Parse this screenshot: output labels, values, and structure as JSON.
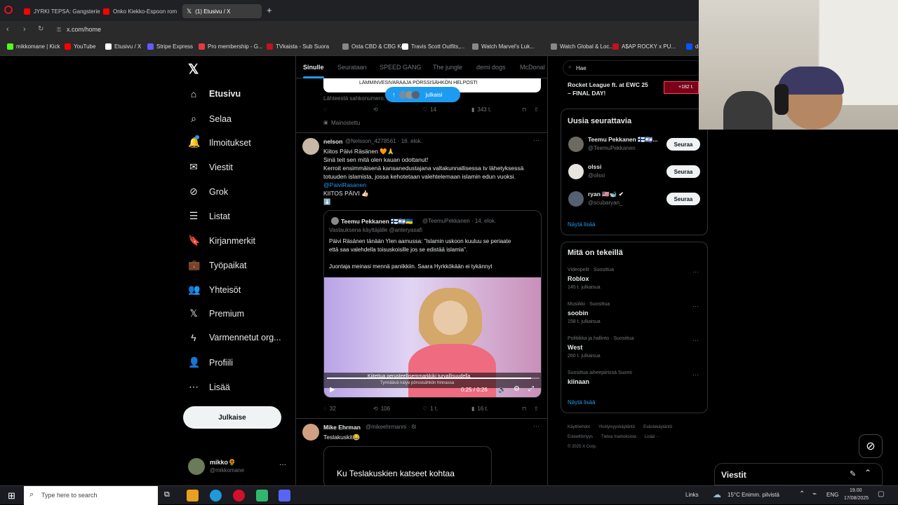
{
  "browser": {
    "tabs": [
      {
        "label": "JYRKI TEPSA: Gangsteriel",
        "color": "#ff0000"
      },
      {
        "label": "Onko Kiekko-Espoon rom",
        "color": "#ff0000"
      },
      {
        "label": "(1) Etusivu / X",
        "color": "#ffffff"
      }
    ],
    "new_tab": "+",
    "url": "x.com/home",
    "bookmarks": [
      {
        "label": "mikkomane | Kick",
        "color": "#53fc18"
      },
      {
        "label": "YouTube",
        "color": "#ff0000"
      },
      {
        "label": "Etusivu / X",
        "color": "#ffffff"
      },
      {
        "label": "Stripe Express",
        "color": "#635bff"
      },
      {
        "label": "Pro membership - G...",
        "color": "#e63946"
      },
      {
        "label": "TVkaista - Sub Suora",
        "color": "#c1121f"
      },
      {
        "label": "Osta CBD & CBG Ke...",
        "color": "#888888"
      },
      {
        "label": "Travis Scott Outfits,...",
        "color": "#ffffff"
      },
      {
        "label": "Watch Marvel's Luk...",
        "color": "#888888"
      },
      {
        "label": "Watch Global & Loc...",
        "color": "#888888"
      },
      {
        "label": "A$AP ROCKY x PU...",
        "color": "#c1121f"
      },
      {
        "label": "de",
        "color": "#0057ff"
      }
    ]
  },
  "left_nav": {
    "items": [
      {
        "label": "Etusivu",
        "icon": "home-icon",
        "glyph": "⌂"
      },
      {
        "label": "Selaa",
        "icon": "search-icon",
        "glyph": "⌕"
      },
      {
        "label": "Ilmoitukset",
        "icon": "bell-icon",
        "glyph": "🔔"
      },
      {
        "label": "Viestit",
        "icon": "mail-icon",
        "glyph": "✉"
      },
      {
        "label": "Grok",
        "icon": "grok-icon",
        "glyph": "⊘"
      },
      {
        "label": "Listat",
        "icon": "list-icon",
        "glyph": "☰"
      },
      {
        "label": "Kirjanmerkit",
        "icon": "bookmark-icon",
        "glyph": "🔖"
      },
      {
        "label": "Työpaikat",
        "icon": "briefcase-icon",
        "glyph": "💼"
      },
      {
        "label": "Yhteisöt",
        "icon": "community-icon",
        "glyph": "👥"
      },
      {
        "label": "Premium",
        "icon": "x-logo-icon",
        "glyph": "𝕏"
      },
      {
        "label": "Varmennetut org...",
        "icon": "lightning-icon",
        "glyph": "ϟ"
      },
      {
        "label": "Profiili",
        "icon": "profile-icon",
        "glyph": "👤"
      },
      {
        "label": "Lisää",
        "icon": "more-circle-icon",
        "glyph": "⋯"
      }
    ],
    "post_button": "Julkaise",
    "account": {
      "name": "mikko🌻",
      "handle": "@mikkomane",
      "more": "···"
    }
  },
  "feed": {
    "tabs": [
      "Sinulle",
      "Seurataan",
      "SPEED GANG",
      "The jungle",
      "demi dogs",
      "McDonal"
    ],
    "ad_tweet": {
      "card_text": "LÄMMINVESIVARAAJA PÖRSSISÄHKÖN HELPOSTI",
      "new_posts_pill": "julkaisi",
      "source": "Lähteestä sahkonumero.",
      "likes": "14",
      "views": "343 t.",
      "promoted": "Mainostettu"
    },
    "tweet1": {
      "name": "nelson",
      "handle": "@Nelsson_4278561 · 16. elok.",
      "lines": [
        "Kiitos Päivi Räsänen 🧡🙏",
        "Sinä teit sen mitä olen kauan odottanut!",
        "Kerroit ensimmäisenä kansanedustajana valtakunnallisessa tv lähetyksessä",
        "totuuden islamista, jossa kehotetaan valehtelemaan islamin edun vuoksi."
      ],
      "mention": "@PaiviRasanen",
      "line_after": "KIITOS PÄIVI 👍🏻",
      "emoji_line": "⬇️",
      "quote": {
        "name": "Teemu Pekkanen 🇫🇮🇮🇱🇺🇦",
        "handle": "@TeemuPekkanen · 14. elok.",
        "reply_to": "Vastauksena käyttäjälle @anteryasafi",
        "text1": "Päivi Räsänen tänään Ylen aamussa: \"Islamin uskoon kuuluu se periaate",
        "text2": "että saa valehdella toisuskoisille jos se edistää islamia\".",
        "text3": "Juontaja meinasi mennä paniikkiin. Saara Hyrkkökään ei tykännyt"
      },
      "video": {
        "caption": "Kiitettua perusteellisemmarkkiki turvallisuudella",
        "ticker": "Tyrmäävä naiye pörssisähkön hinnassa",
        "time": "0:25 / 0:26",
        "progress": 0.96
      },
      "replies": "32",
      "reposts": "106",
      "likes": "1 t.",
      "views": "16 t."
    },
    "tweet2": {
      "name": "Mike Ehrman",
      "handle": "@mikeehrmanni · 6t",
      "text": "Teslakuskit😂",
      "card_title": "Ku Teslakuskien katseet kohtaa"
    }
  },
  "right": {
    "search_text": "Hae",
    "top_trend": {
      "line1": "Rocket League ft. at EWC 25",
      "line2": "– FINAL DAY!",
      "badge": "+182 t."
    },
    "who_to_follow": {
      "title": "Uusia seurattavia",
      "users": [
        {
          "name": "Teemu Pekkanen 🇫🇮🇮🇱...",
          "handle": "@TeemuPekkanen",
          "button": "Seuraa"
        },
        {
          "name": "olssi",
          "handle": "@olssi",
          "button": "Seuraa"
        },
        {
          "name": "ryan 🇺🇸🐋 ✔",
          "handle": "@scubaryan_",
          "button": "Seuraa"
        }
      ],
      "show_more": "Näytä lisää"
    },
    "trends": {
      "title": "Mitä on tekeillä",
      "items": [
        {
          "category": "Videopelit · Suosittua",
          "name": "Roblox",
          "count": "145 t. julkaisua"
        },
        {
          "category": "Musiikki · Suosittua",
          "name": "soobin",
          "count": "158 t. julkaisua"
        },
        {
          "category": "Politiikka ja hallinto · Suosittua",
          "name": "West",
          "count": "260 t. julkaisua"
        },
        {
          "category": "Suosittua aiheepiirissä Suomi",
          "name": "kiinaan",
          "count": ""
        }
      ],
      "show_more": "Näytä lisää"
    },
    "footer": {
      "line1": [
        "Käyttöehdot",
        "Yksityisyyskäytäntö",
        "Evästekäytäntö"
      ],
      "line2": [
        "Esteettömyys",
        "Tietoa mainoksista",
        "Lisää ···"
      ],
      "copyright": "© 2025 X Corp."
    },
    "messages_dock": "Viestit"
  },
  "taskbar": {
    "search_placeholder": "Type here to search",
    "links": "Links",
    "weather": "15°C  Enimm. pilvistä",
    "lang": "ENG",
    "time": "19.00",
    "date": "17/08/2025"
  }
}
